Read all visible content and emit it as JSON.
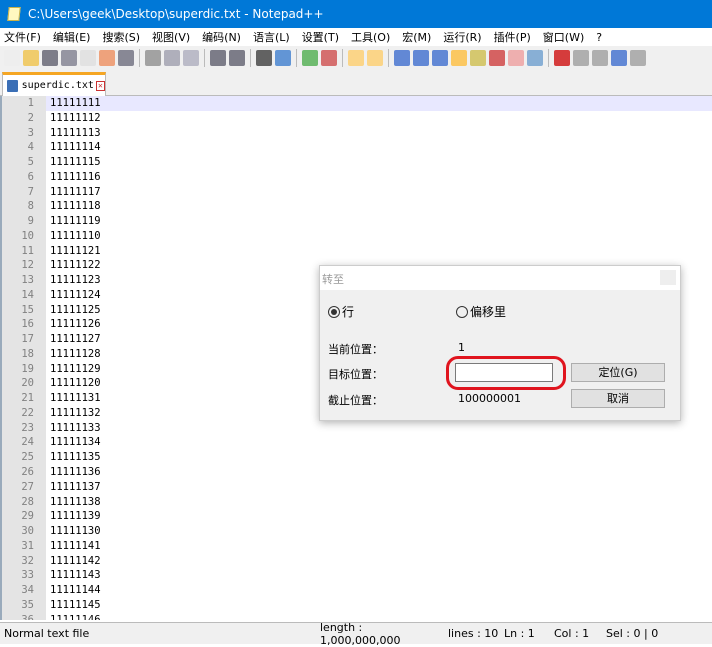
{
  "window": {
    "title": "C:\\Users\\geek\\Desktop\\superdic.txt - Notepad++"
  },
  "menu": [
    "文件(F)",
    "编辑(E)",
    "搜索(S)",
    "视图(V)",
    "编码(N)",
    "语言(L)",
    "设置(T)",
    "工具(O)",
    "宏(M)",
    "运行(R)",
    "插件(P)",
    "窗口(W)",
    "?"
  ],
  "tab": {
    "label": "superdic.txt"
  },
  "lines": [
    [
      "1",
      "11111111"
    ],
    [
      "2",
      "11111112"
    ],
    [
      "3",
      "11111113"
    ],
    [
      "4",
      "11111114"
    ],
    [
      "5",
      "11111115"
    ],
    [
      "6",
      "11111116"
    ],
    [
      "7",
      "11111117"
    ],
    [
      "8",
      "11111118"
    ],
    [
      "9",
      "11111119"
    ],
    [
      "10",
      "11111110"
    ],
    [
      "11",
      "11111121"
    ],
    [
      "12",
      "11111122"
    ],
    [
      "13",
      "11111123"
    ],
    [
      "14",
      "11111124"
    ],
    [
      "15",
      "11111125"
    ],
    [
      "16",
      "11111126"
    ],
    [
      "17",
      "11111127"
    ],
    [
      "18",
      "11111128"
    ],
    [
      "19",
      "11111129"
    ],
    [
      "20",
      "11111120"
    ],
    [
      "21",
      "11111131"
    ],
    [
      "22",
      "11111132"
    ],
    [
      "23",
      "11111133"
    ],
    [
      "24",
      "11111134"
    ],
    [
      "25",
      "11111135"
    ],
    [
      "26",
      "11111136"
    ],
    [
      "27",
      "11111137"
    ],
    [
      "28",
      "11111138"
    ],
    [
      "29",
      "11111139"
    ],
    [
      "30",
      "11111130"
    ],
    [
      "31",
      "11111141"
    ],
    [
      "32",
      "11111142"
    ],
    [
      "33",
      "11111143"
    ],
    [
      "34",
      "11111144"
    ],
    [
      "35",
      "11111145"
    ],
    [
      "36",
      "11111146"
    ]
  ],
  "status": {
    "type": "Normal text file",
    "length": "length : 1,000,000,000",
    "lines": "lines : 10",
    "ln": "Ln : 1",
    "col": "Col : 1",
    "sel": "Sel : 0 | 0"
  },
  "dialog": {
    "title": "转至",
    "radio_line": "行",
    "radio_offset": "偏移里",
    "radio_selected": "line",
    "current_label": "当前位置：",
    "current_value": "1",
    "target_label": "目标位置：",
    "target_value": "",
    "end_label": "截止位置：",
    "end_value": "100000001",
    "go_button": "定位(G)",
    "cancel_button": "取消",
    "highlight_color": "#e0141e"
  }
}
